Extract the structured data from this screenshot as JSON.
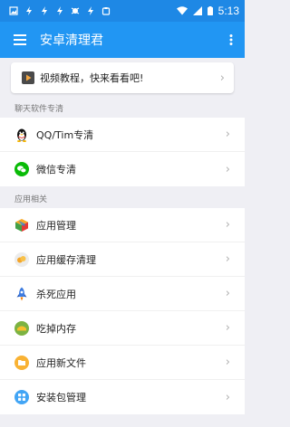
{
  "status": {
    "time": "5:13",
    "bar_color": "#1e88e5"
  },
  "appbar": {
    "title": "安卓清理君",
    "color": "#2196f3",
    "menu_icon": "hamburger-menu-icon",
    "more_icon": "more-vertical-icon"
  },
  "promo": {
    "label": "视频教程，快来看看吧!",
    "icon": "video-icon"
  },
  "sections": [
    {
      "header": "聊天软件专清",
      "items": [
        {
          "label": "QQ/Tim专清",
          "icon": "qq-penguin-icon"
        },
        {
          "label": "微信专清",
          "icon": "wechat-icon"
        }
      ]
    },
    {
      "header": "应用相关",
      "items": [
        {
          "label": "应用管理",
          "icon": "cube-icon"
        },
        {
          "label": "应用缓存清理",
          "icon": "cache-icon"
        },
        {
          "label": "杀死应用",
          "icon": "rocket-icon"
        },
        {
          "label": "吃掉内存",
          "icon": "memory-icon"
        },
        {
          "label": "应用新文件",
          "icon": "folder-icon"
        },
        {
          "label": "安装包管理",
          "icon": "package-icon"
        }
      ]
    }
  ]
}
